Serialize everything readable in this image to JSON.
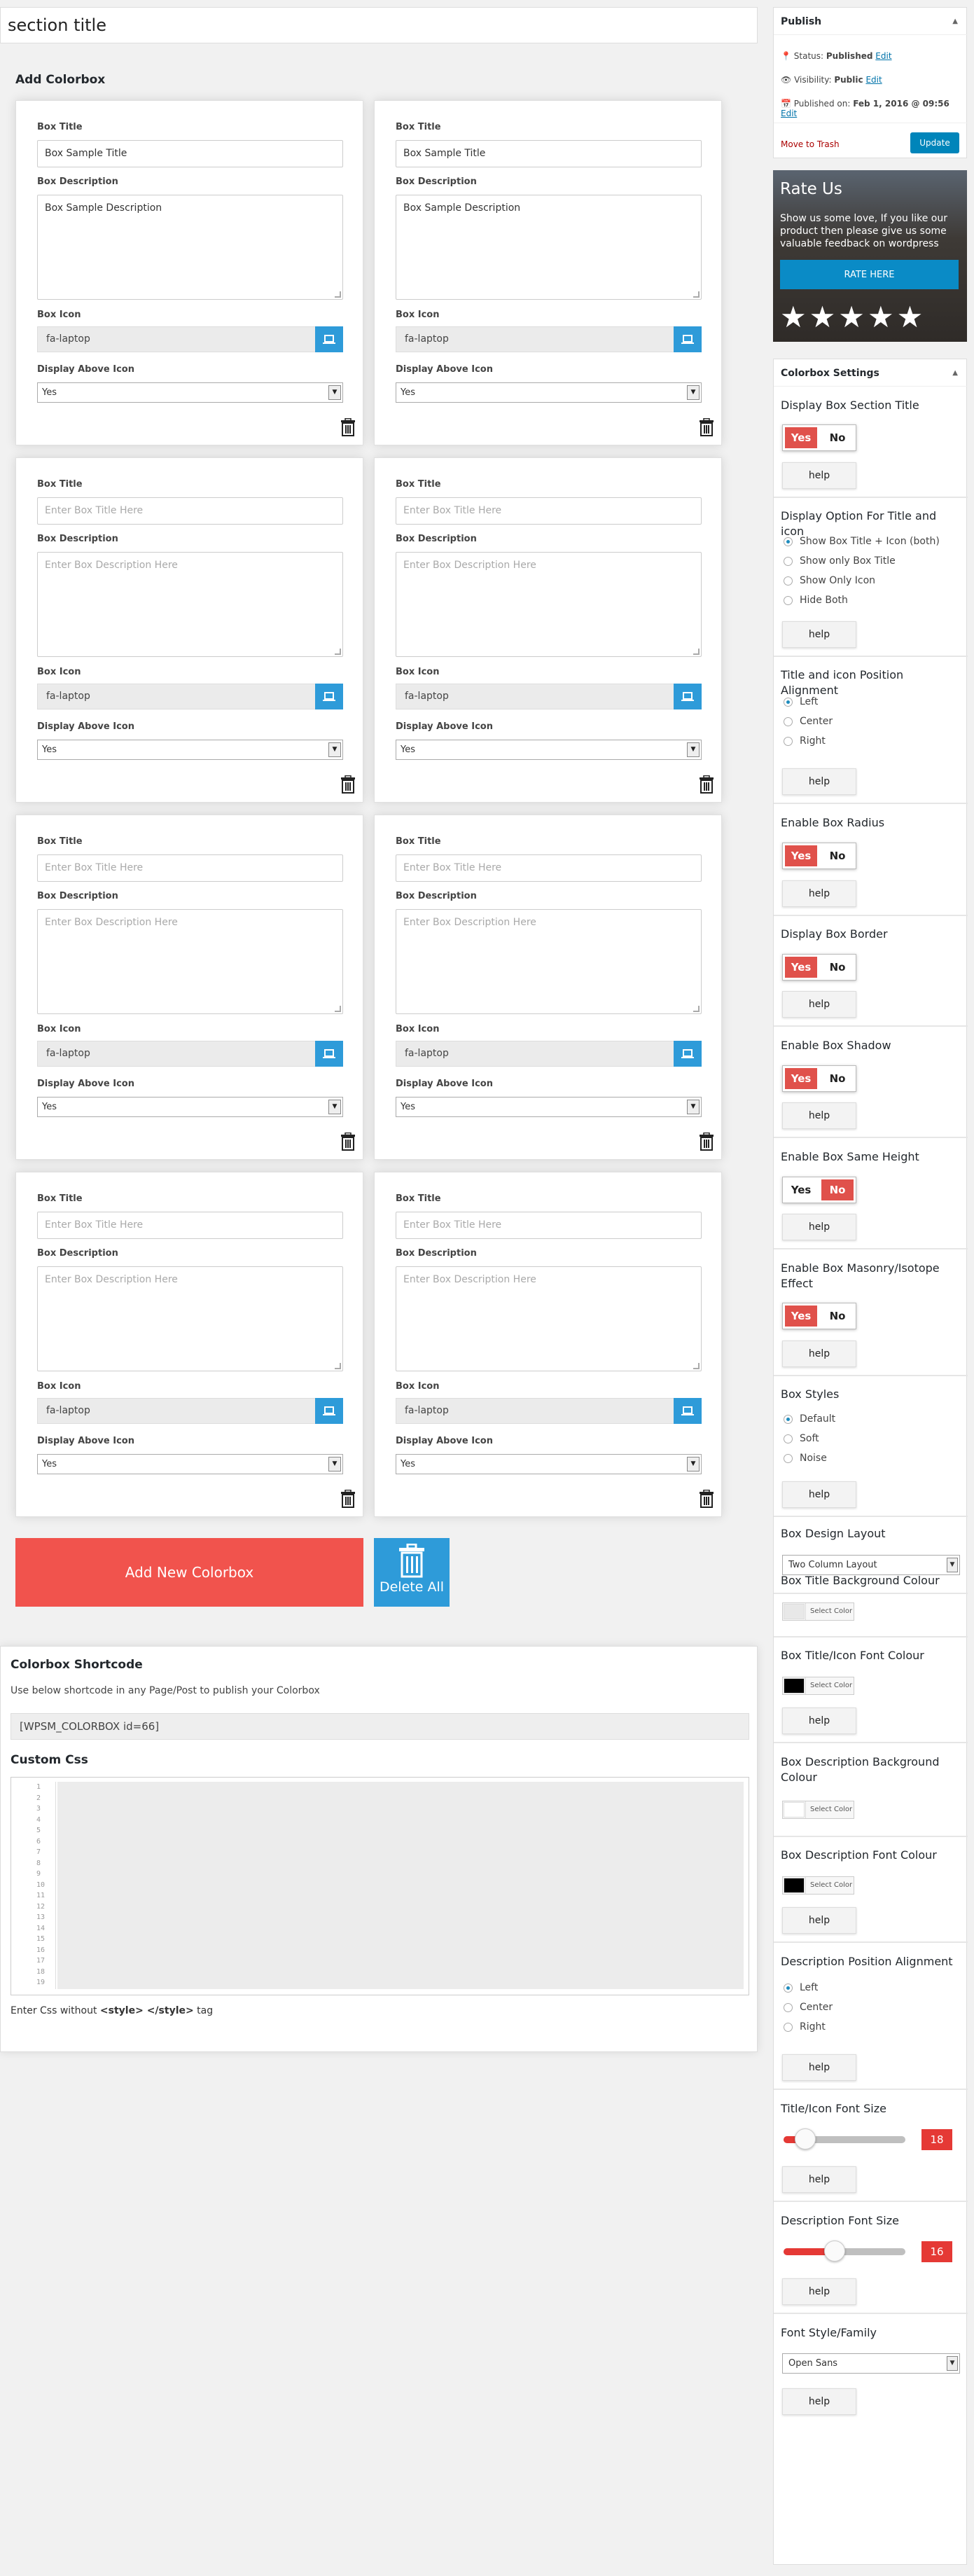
{
  "section_title": "section title",
  "add_colorbox_heading": "Add Colorbox",
  "labels": {
    "box_title": "Box Title",
    "box_description": "Box Description",
    "box_icon": "Box Icon",
    "display_above_icon": "Display Above Icon"
  },
  "cards": [
    {
      "title": "Box Sample Title",
      "title_placeholder": false,
      "description": "Box Sample Description",
      "desc_placeholder": false,
      "icon": "fa-laptop",
      "display_above": "Yes"
    },
    {
      "title": "Box Sample Title",
      "title_placeholder": false,
      "description": "Box Sample Description",
      "desc_placeholder": false,
      "icon": "fa-laptop",
      "display_above": "Yes"
    },
    {
      "title": "Enter Box Title Here",
      "title_placeholder": true,
      "description": "Enter Box Description Here",
      "desc_placeholder": true,
      "icon": "fa-laptop",
      "display_above": "Yes"
    },
    {
      "title": "Enter Box Title Here",
      "title_placeholder": true,
      "description": "Enter Box Description Here",
      "desc_placeholder": true,
      "icon": "fa-laptop",
      "display_above": "Yes"
    },
    {
      "title": "Enter Box Title Here",
      "title_placeholder": true,
      "description": "Enter Box Description Here",
      "desc_placeholder": true,
      "icon": "fa-laptop",
      "display_above": "Yes"
    },
    {
      "title": "Enter Box Title Here",
      "title_placeholder": true,
      "description": "Enter Box Description Here",
      "desc_placeholder": true,
      "icon": "fa-laptop",
      "display_above": "Yes"
    },
    {
      "title": "Enter Box Title Here",
      "title_placeholder": true,
      "description": "Enter Box Description Here",
      "desc_placeholder": true,
      "icon": "fa-laptop",
      "display_above": "Yes"
    },
    {
      "title": "Enter Box Title Here",
      "title_placeholder": true,
      "description": "Enter Box Description Here",
      "desc_placeholder": true,
      "icon": "fa-laptop",
      "display_above": "Yes"
    }
  ],
  "add_new_label": "Add New Colorbox",
  "delete_all_label": "Delete All",
  "shortcode": {
    "heading": "Colorbox Shortcode",
    "description": "Use below shortcode in any Page/Post to publish your Colorbox",
    "value": "[WPSM_COLORBOX id=66]",
    "css_heading": "Custom Css",
    "line_numbers": [
      "1",
      "2",
      "3",
      "4",
      "5",
      "6",
      "7",
      "8",
      "9",
      "10",
      "11",
      "12",
      "13",
      "14",
      "15",
      "16",
      "17",
      "18",
      "19"
    ],
    "note_prefix": "Enter Css without ",
    "note_tag": "<style> </style>",
    "note_suffix": " tag"
  },
  "publish": {
    "heading": "Publish",
    "status_label": "Status: ",
    "status_value": "Published",
    "visibility_label": "Visibility: ",
    "visibility_value": "Public",
    "published_label": "Published on: ",
    "published_value": "Feb 1, 2016 @ 09:56",
    "edit": "Edit",
    "trash": "Move to Trash",
    "update": "Update"
  },
  "rate": {
    "heading": "Rate Us",
    "text": "Show us some love, If you like our product then please give us some valuable feedback on wordpress",
    "button": "RATE HERE",
    "stars": "★★★★★"
  },
  "settings": {
    "heading": "Colorbox Settings",
    "help": "help",
    "yes": "Yes",
    "no": "No",
    "display_section_title": "Display Box Section Title",
    "display_option": "Display Option For Title and icon",
    "display_option_items": [
      "Show Box Title + Icon (both)",
      "Show only Box Title",
      "Show Only Icon",
      "Hide Both"
    ],
    "position_alignment": "Title and icon Position Alignment",
    "alignment_items": [
      "Left",
      "Center",
      "Right"
    ],
    "enable_radius": "Enable Box Radius",
    "display_border": "Display Box Border",
    "enable_shadow": "Enable Box Shadow",
    "same_height": "Enable Box Same Height",
    "masonry": "Enable Box Masonry/Isotope Effect",
    "box_styles": "Box Styles",
    "style_items": [
      "Default",
      "Soft",
      "Noise"
    ],
    "design_layout": "Box Design Layout",
    "design_layout_value": "Two Column Layout",
    "title_bg": "Box Title Background Colour",
    "title_font_colour": "Box Title/Icon Font Colour",
    "desc_bg": "Box Description Background Colour",
    "desc_font_colour": "Box Description Font Colour",
    "select_color": "Select Color",
    "desc_alignment": "Description Position Alignment",
    "title_font_size": "Title/Icon Font Size",
    "title_font_size_value": "18",
    "desc_font_size": "Description Font Size",
    "desc_font_size_value": "16",
    "font_family": "Font Style/Family",
    "font_family_value": "Open Sans"
  },
  "colors": {
    "accent_red": "#e0514b",
    "accent_blue": "#2e9bd9",
    "swatch_title_bg": "#e8e8e8",
    "swatch_title_font": "#000000",
    "swatch_desc_bg": "#ffffff",
    "swatch_desc_font": "#000000"
  },
  "sliders": {
    "title_font_fraction": 0.18,
    "desc_font_fraction": 0.42
  }
}
